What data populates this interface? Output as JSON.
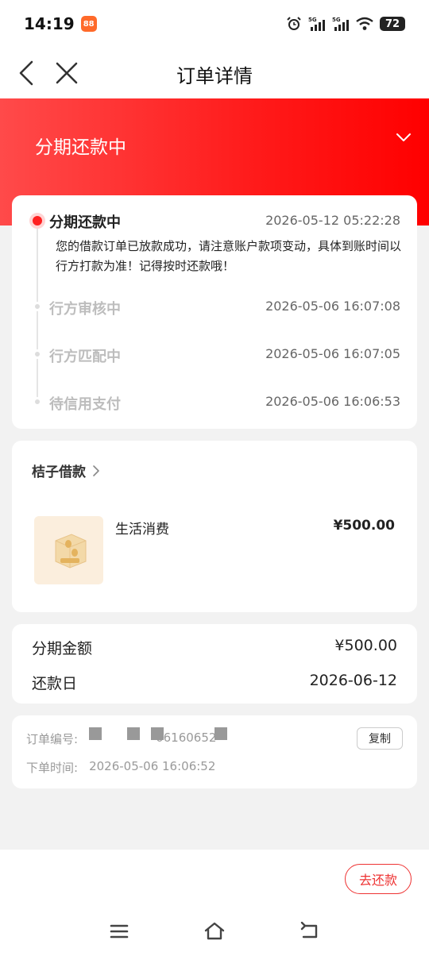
{
  "status_bar": {
    "time": "14:19",
    "app_badge": "88",
    "net1": "5G",
    "net2": "5G",
    "battery": "72"
  },
  "nav": {
    "title": "订单详情"
  },
  "banner": {
    "title": "分期还款中"
  },
  "timeline": {
    "items": [
      {
        "title": "分期还款中",
        "time": "2026-05-12 05:22:28",
        "desc": "您的借款订单已放款成功，请注意账户款项变动，具体到账时间以行方打款为准！记得按时还款哦！",
        "active": true
      },
      {
        "title": "行方审核中",
        "time": "2026-05-06 16:07:08",
        "active": false
      },
      {
        "title": "行方匹配中",
        "time": "2026-05-06 16:07:05",
        "active": false
      },
      {
        "title": "待信用支付",
        "time": "2026-05-06 16:06:53",
        "active": false
      }
    ]
  },
  "product": {
    "merchant": "桔子借款",
    "name": "生活消费",
    "price": "¥500.00"
  },
  "amounts": {
    "installment_label": "分期金额",
    "installment_value": "¥500.00",
    "repay_day_label": "还款日",
    "repay_day_value": "2026-06-12"
  },
  "order": {
    "number_label": "订单编号:",
    "number_value": "06160652",
    "time_label": "下单时间:",
    "time_value": "2026-05-06 16:06:52",
    "copy_label": "复制"
  },
  "actions": {
    "repay_label": "去还款"
  },
  "colors": {
    "accent": "#ff1a1a",
    "banner_start": "#ff4a4a",
    "banner_end": "#ff0000"
  }
}
